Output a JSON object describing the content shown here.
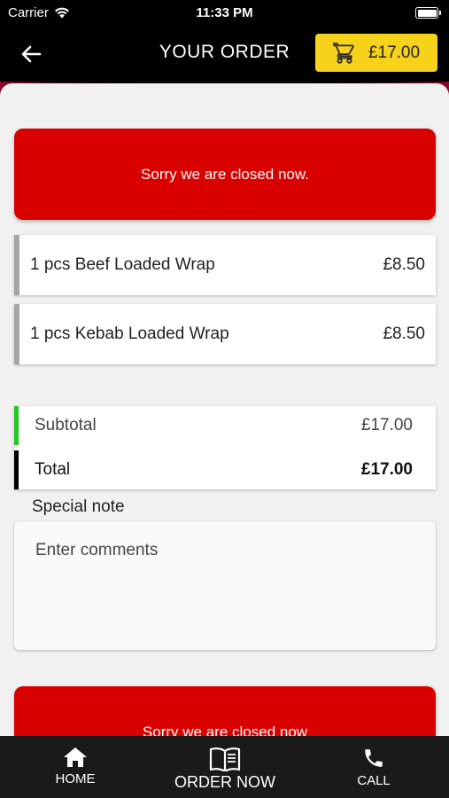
{
  "status_bar": {
    "carrier": "Carrier",
    "time": "11:33 PM"
  },
  "header": {
    "title": "YOUR ORDER",
    "cart_total": "£17.00"
  },
  "closed_message": "Sorry we are closed now.",
  "order_items": [
    {
      "name": "1 pcs Beef Loaded Wrap",
      "price": "£8.50"
    },
    {
      "name": "1 pcs Kebab Loaded Wrap",
      "price": "£8.50"
    }
  ],
  "totals": {
    "subtotal_label": "Subtotal",
    "subtotal_value": "£17.00",
    "total_label": "Total",
    "total_value": "£17.00"
  },
  "special_note": {
    "label": "Special note",
    "placeholder": "Enter comments"
  },
  "bottom_banner": "Sorry we are closed now",
  "nav": {
    "home": "HOME",
    "order_now": "ORDER NOW",
    "call": "CALL"
  },
  "colors": {
    "closed_banner": "#d90000",
    "cart_button": "#f7d21a",
    "subtotal_accent": "#22c822",
    "total_accent": "#000000",
    "item_accent": "#a6a6a6"
  }
}
